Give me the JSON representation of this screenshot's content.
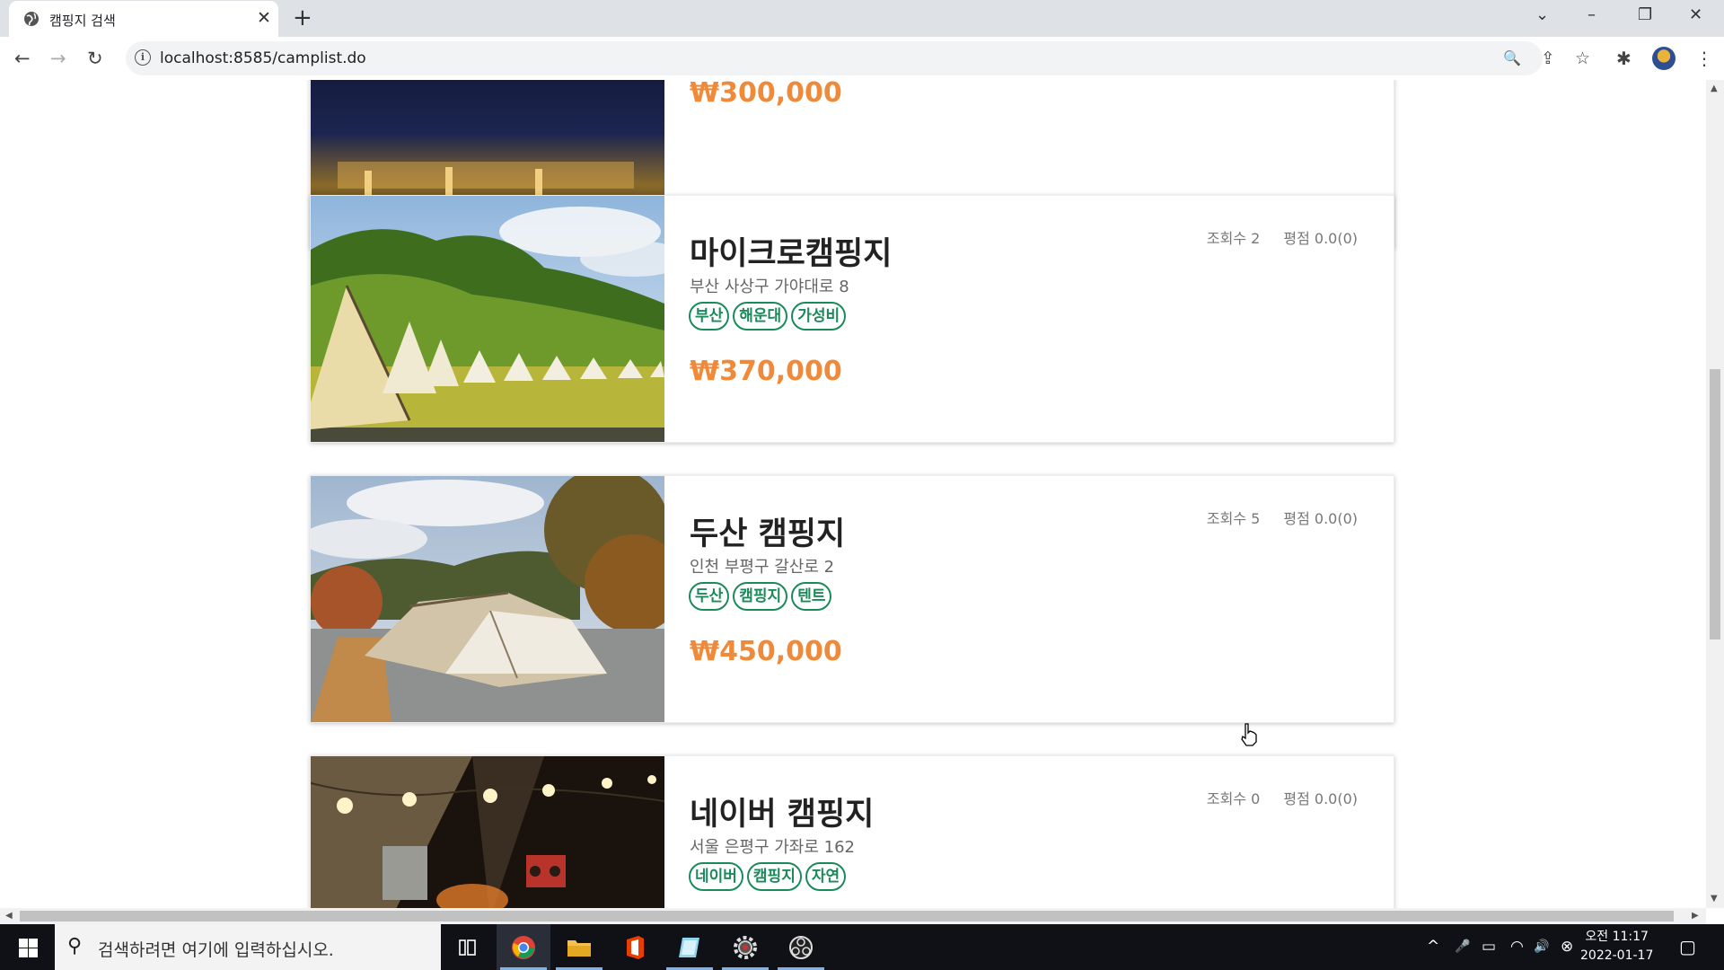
{
  "browser": {
    "tab_title": "캠핑지 검색",
    "tab_close": "✕",
    "new_tab": "+",
    "url": "localhost:8585/camplist.do",
    "window_controls": {
      "tab_search": "⌄",
      "minimize": "–",
      "restore": "❐",
      "close": "✕"
    },
    "nav": {
      "back": "←",
      "forward": "→",
      "reload": "↻"
    },
    "omnibox_icons": {
      "zoom": "🔍",
      "share": "⇪",
      "bookmark": "☆"
    },
    "extensions": "✱",
    "menu": "⋮"
  },
  "partial_card": {
    "price": "₩300,000"
  },
  "camps": [
    {
      "name": "마이크로캠핑지",
      "address": "부산 사상구 가야대로 8",
      "tags": [
        "부산",
        "해운대",
        "가성비"
      ],
      "price": "₩370,000",
      "views": "조회수 2",
      "rating": "평점 0.0(0)"
    },
    {
      "name": "두산 캠핑지",
      "address": "인천 부평구 갈산로 2",
      "tags": [
        "두산",
        "캠핑지",
        "텐트"
      ],
      "price": "₩450,000",
      "views": "조회수 5",
      "rating": "평점 0.0(0)"
    },
    {
      "name": "네이버 캠핑지",
      "address": "서울 은평구 가좌로 162",
      "tags": [
        "네이버",
        "캠핑지",
        "자연"
      ],
      "views": "조회수 0",
      "rating": "평점 0.0(0)"
    }
  ],
  "taskbar": {
    "search_placeholder": "검색하려면 여기에 입력하십시오.",
    "tray": {
      "chevron": "^",
      "mic": "🎤",
      "battery": "▭",
      "wifi": "◠",
      "volume": "🔊",
      "x": "⊗",
      "notification": "▢"
    },
    "time": "오전 11:17",
    "date": "2022-01-17"
  }
}
